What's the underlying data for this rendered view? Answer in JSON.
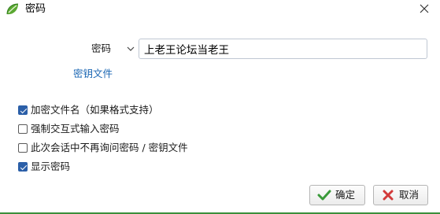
{
  "window": {
    "title": "密码",
    "app_icon": "green-leaf-app-icon",
    "close_icon": "close-icon"
  },
  "password": {
    "label": "密码",
    "dropdown_icon": "chevron-down-icon",
    "value": "上老王论坛当老王"
  },
  "keyfile_link": "密钥文件",
  "options": [
    {
      "label": "加密文件名（如果格式支持）",
      "checked": true
    },
    {
      "label": "强制交互式输入密码",
      "checked": false
    },
    {
      "label": "此次会话中不再询问密码 / 密钥文件",
      "checked": false
    },
    {
      "label": "显示密码",
      "checked": true
    }
  ],
  "buttons": {
    "ok_label": "确定",
    "ok_icon": "checkmark-icon",
    "cancel_label": "取消",
    "cancel_icon": "x-cross-icon"
  },
  "colors": {
    "accent": "#2b5fa8",
    "link": "#1a66b3",
    "ok_icon": "#3a9a3a",
    "cancel_icon": "#d23a3a",
    "bottom_strip": "#3c8f3c"
  }
}
